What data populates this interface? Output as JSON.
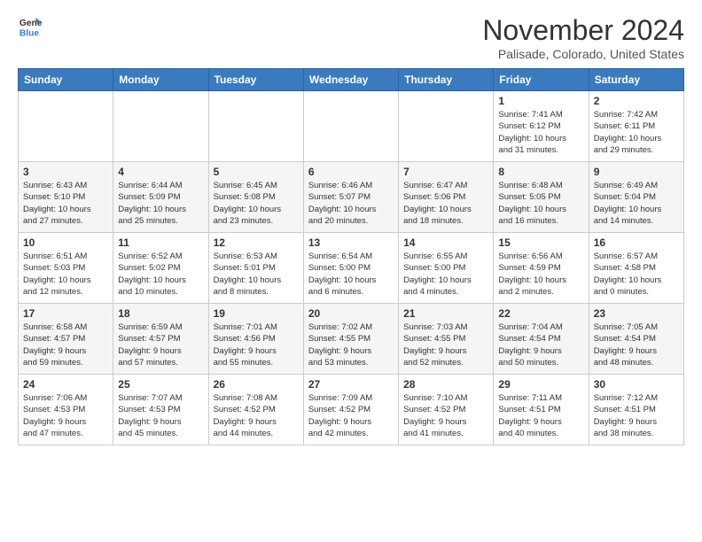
{
  "header": {
    "logo_line1": "General",
    "logo_line2": "Blue",
    "month": "November 2024",
    "location": "Palisade, Colorado, United States"
  },
  "weekdays": [
    "Sunday",
    "Monday",
    "Tuesday",
    "Wednesday",
    "Thursday",
    "Friday",
    "Saturday"
  ],
  "weeks": [
    [
      {
        "day": "",
        "info": ""
      },
      {
        "day": "",
        "info": ""
      },
      {
        "day": "",
        "info": ""
      },
      {
        "day": "",
        "info": ""
      },
      {
        "day": "",
        "info": ""
      },
      {
        "day": "1",
        "info": "Sunrise: 7:41 AM\nSunset: 6:12 PM\nDaylight: 10 hours\nand 31 minutes."
      },
      {
        "day": "2",
        "info": "Sunrise: 7:42 AM\nSunset: 6:11 PM\nDaylight: 10 hours\nand 29 minutes."
      }
    ],
    [
      {
        "day": "3",
        "info": "Sunrise: 6:43 AM\nSunset: 5:10 PM\nDaylight: 10 hours\nand 27 minutes."
      },
      {
        "day": "4",
        "info": "Sunrise: 6:44 AM\nSunset: 5:09 PM\nDaylight: 10 hours\nand 25 minutes."
      },
      {
        "day": "5",
        "info": "Sunrise: 6:45 AM\nSunset: 5:08 PM\nDaylight: 10 hours\nand 23 minutes."
      },
      {
        "day": "6",
        "info": "Sunrise: 6:46 AM\nSunset: 5:07 PM\nDaylight: 10 hours\nand 20 minutes."
      },
      {
        "day": "7",
        "info": "Sunrise: 6:47 AM\nSunset: 5:06 PM\nDaylight: 10 hours\nand 18 minutes."
      },
      {
        "day": "8",
        "info": "Sunrise: 6:48 AM\nSunset: 5:05 PM\nDaylight: 10 hours\nand 16 minutes."
      },
      {
        "day": "9",
        "info": "Sunrise: 6:49 AM\nSunset: 5:04 PM\nDaylight: 10 hours\nand 14 minutes."
      }
    ],
    [
      {
        "day": "10",
        "info": "Sunrise: 6:51 AM\nSunset: 5:03 PM\nDaylight: 10 hours\nand 12 minutes."
      },
      {
        "day": "11",
        "info": "Sunrise: 6:52 AM\nSunset: 5:02 PM\nDaylight: 10 hours\nand 10 minutes."
      },
      {
        "day": "12",
        "info": "Sunrise: 6:53 AM\nSunset: 5:01 PM\nDaylight: 10 hours\nand 8 minutes."
      },
      {
        "day": "13",
        "info": "Sunrise: 6:54 AM\nSunset: 5:00 PM\nDaylight: 10 hours\nand 6 minutes."
      },
      {
        "day": "14",
        "info": "Sunrise: 6:55 AM\nSunset: 5:00 PM\nDaylight: 10 hours\nand 4 minutes."
      },
      {
        "day": "15",
        "info": "Sunrise: 6:56 AM\nSunset: 4:59 PM\nDaylight: 10 hours\nand 2 minutes."
      },
      {
        "day": "16",
        "info": "Sunrise: 6:57 AM\nSunset: 4:58 PM\nDaylight: 10 hours\nand 0 minutes."
      }
    ],
    [
      {
        "day": "17",
        "info": "Sunrise: 6:58 AM\nSunset: 4:57 PM\nDaylight: 9 hours\nand 59 minutes."
      },
      {
        "day": "18",
        "info": "Sunrise: 6:59 AM\nSunset: 4:57 PM\nDaylight: 9 hours\nand 57 minutes."
      },
      {
        "day": "19",
        "info": "Sunrise: 7:01 AM\nSunset: 4:56 PM\nDaylight: 9 hours\nand 55 minutes."
      },
      {
        "day": "20",
        "info": "Sunrise: 7:02 AM\nSunset: 4:55 PM\nDaylight: 9 hours\nand 53 minutes."
      },
      {
        "day": "21",
        "info": "Sunrise: 7:03 AM\nSunset: 4:55 PM\nDaylight: 9 hours\nand 52 minutes."
      },
      {
        "day": "22",
        "info": "Sunrise: 7:04 AM\nSunset: 4:54 PM\nDaylight: 9 hours\nand 50 minutes."
      },
      {
        "day": "23",
        "info": "Sunrise: 7:05 AM\nSunset: 4:54 PM\nDaylight: 9 hours\nand 48 minutes."
      }
    ],
    [
      {
        "day": "24",
        "info": "Sunrise: 7:06 AM\nSunset: 4:53 PM\nDaylight: 9 hours\nand 47 minutes."
      },
      {
        "day": "25",
        "info": "Sunrise: 7:07 AM\nSunset: 4:53 PM\nDaylight: 9 hours\nand 45 minutes."
      },
      {
        "day": "26",
        "info": "Sunrise: 7:08 AM\nSunset: 4:52 PM\nDaylight: 9 hours\nand 44 minutes."
      },
      {
        "day": "27",
        "info": "Sunrise: 7:09 AM\nSunset: 4:52 PM\nDaylight: 9 hours\nand 42 minutes."
      },
      {
        "day": "28",
        "info": "Sunrise: 7:10 AM\nSunset: 4:52 PM\nDaylight: 9 hours\nand 41 minutes."
      },
      {
        "day": "29",
        "info": "Sunrise: 7:11 AM\nSunset: 4:51 PM\nDaylight: 9 hours\nand 40 minutes."
      },
      {
        "day": "30",
        "info": "Sunrise: 7:12 AM\nSunset: 4:51 PM\nDaylight: 9 hours\nand 38 minutes."
      }
    ]
  ]
}
